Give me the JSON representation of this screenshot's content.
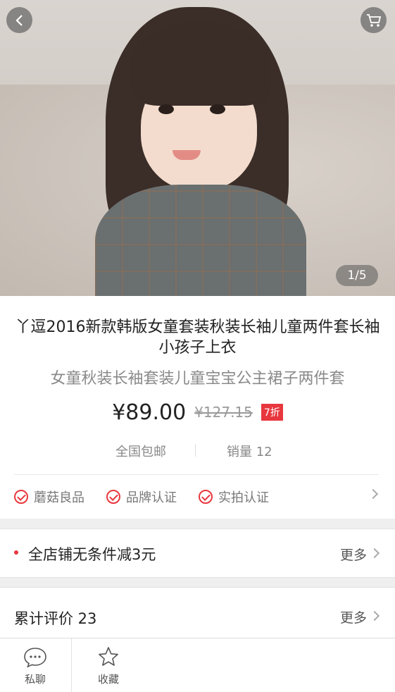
{
  "gallery": {
    "pager_text": "1/5"
  },
  "product": {
    "title": "丫逗2016新款韩版女童套装秋装长袖儿童两件套长袖小孩子上衣",
    "subtitle": "女童秋装长袖套装儿童宝宝公主裙子两件套",
    "price": "¥89.00",
    "original_price": "¥127.15",
    "discount_tag": "7折",
    "shipping": "全国包邮",
    "sales": "销量 12",
    "badges": [
      "蘑菇良品",
      "品牌认证",
      "实拍认证"
    ]
  },
  "promo": {
    "text": "全店铺无条件减3元",
    "more": "更多"
  },
  "reviews": {
    "title": "累计评价 23",
    "more": "更多"
  },
  "bottom_bar": {
    "chat_label": "私聊",
    "favorite_label": "收藏"
  },
  "colors": {
    "accent": "#e8373e"
  }
}
